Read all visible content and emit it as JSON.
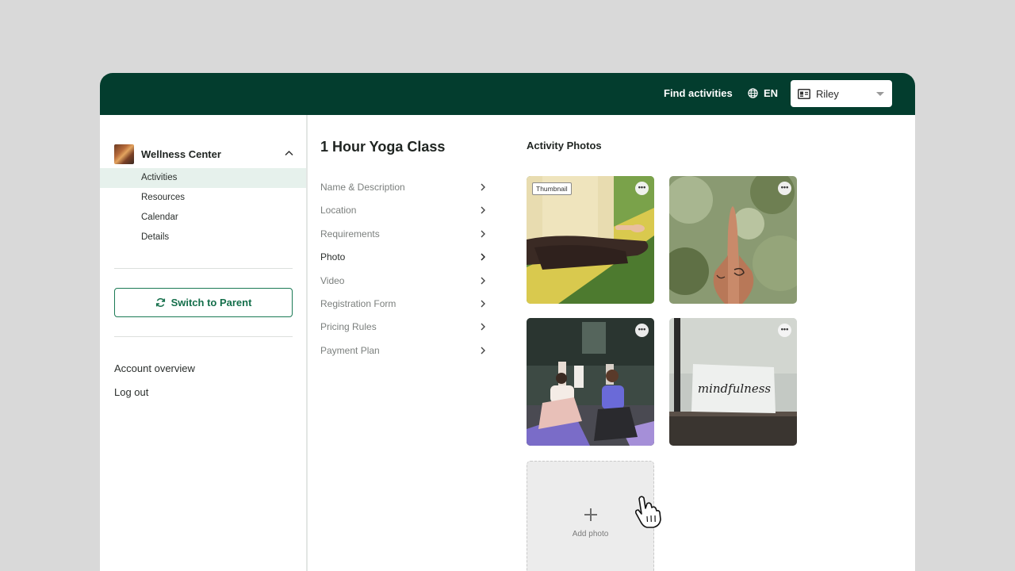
{
  "topbar": {
    "find_activities": "Find activities",
    "language": "EN",
    "user": "Riley",
    "background_color": "#033d2e"
  },
  "sidebar": {
    "org_name": "Wellness Center",
    "items": [
      {
        "label": "Activities",
        "active": true
      },
      {
        "label": "Resources",
        "active": false
      },
      {
        "label": "Calendar",
        "active": false
      },
      {
        "label": "Details",
        "active": false
      }
    ],
    "switch_button": "Switch to Parent",
    "account_overview": "Account overview",
    "logout": "Log out"
  },
  "activity": {
    "title": "1 Hour Yoga Class",
    "menu": [
      {
        "label": "Name & Description",
        "active": false
      },
      {
        "label": "Location",
        "active": false
      },
      {
        "label": "Requirements",
        "active": false
      },
      {
        "label": "Photo",
        "active": true
      },
      {
        "label": "Video",
        "active": false
      },
      {
        "label": "Registration Form",
        "active": false
      },
      {
        "label": "Pricing Rules",
        "active": false
      },
      {
        "label": "Payment Plan",
        "active": false
      }
    ]
  },
  "photos": {
    "title": "Activity Photos",
    "thumbnail_badge": "Thumbnail",
    "more_label": "•••",
    "items": [
      {
        "subject": "meditation-on-yoga-mat"
      },
      {
        "subject": "prayer-hands"
      },
      {
        "subject": "yoga-group-class"
      },
      {
        "subject": "mindfulness-card",
        "caption": "mindfulness"
      }
    ],
    "add_label": "Add photo"
  },
  "colors": {
    "accent": "#1b7a55",
    "active_bg": "#e6f1ec"
  }
}
